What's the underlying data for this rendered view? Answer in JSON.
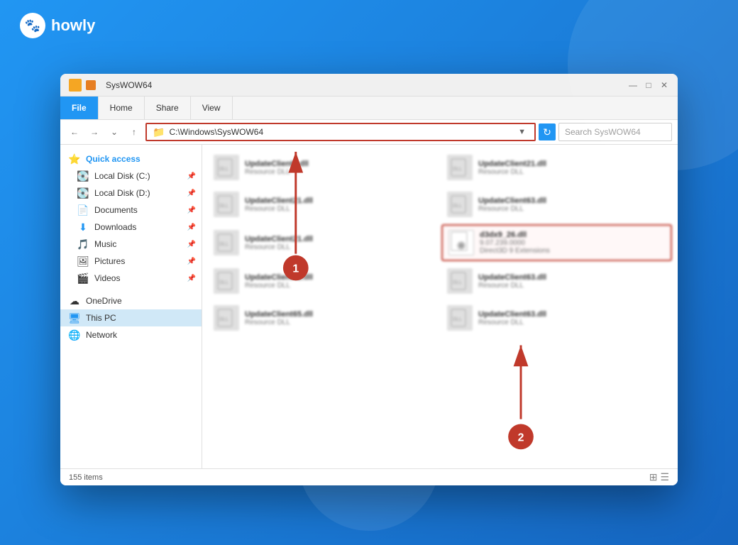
{
  "brand": {
    "name": "howly",
    "icon": "🐾"
  },
  "window": {
    "title": "SysWOW64",
    "minimize_label": "—",
    "maximize_label": "□",
    "close_label": "✕"
  },
  "ribbon": {
    "tabs": [
      {
        "id": "file",
        "label": "File",
        "active": true
      },
      {
        "id": "home",
        "label": "Home",
        "active": false
      },
      {
        "id": "share",
        "label": "Share",
        "active": false
      },
      {
        "id": "view",
        "label": "View",
        "active": false
      }
    ]
  },
  "address_bar": {
    "path": "C:\\Windows\\SysWOW64",
    "search_placeholder": "Search SysWOW64",
    "folder_icon": "📁"
  },
  "sidebar": {
    "items": [
      {
        "id": "quick-access",
        "label": "Quick access",
        "icon": "⭐",
        "type": "header"
      },
      {
        "id": "local-disk-c",
        "label": "Local Disk (C:)",
        "icon": "💽",
        "pinned": true
      },
      {
        "id": "local-disk-d",
        "label": "Local Disk (D:)",
        "icon": "💽",
        "pinned": true
      },
      {
        "id": "documents",
        "label": "Documents",
        "icon": "📄",
        "pinned": true
      },
      {
        "id": "downloads",
        "label": "Downloads",
        "icon": "⬇",
        "pinned": true
      },
      {
        "id": "music",
        "label": "Music",
        "icon": "🎵",
        "pinned": true
      },
      {
        "id": "pictures",
        "label": "Pictures",
        "icon": "🖼",
        "pinned": true
      },
      {
        "id": "videos",
        "label": "Videos",
        "icon": "🎬",
        "pinned": true
      },
      {
        "id": "onedrive",
        "label": "OneDrive",
        "icon": "☁",
        "type": "drive"
      },
      {
        "id": "this-pc",
        "label": "This PC",
        "icon": "🖥",
        "type": "drive",
        "active": true
      },
      {
        "id": "network",
        "label": "Network",
        "icon": "🌐",
        "type": "drive"
      }
    ]
  },
  "files": [
    {
      "id": "f1",
      "name": "UpdateClient5.dll",
      "desc": "Resource DLL",
      "col": 0
    },
    {
      "id": "f2",
      "name": "UpdateClient21.dll",
      "desc": "Resource DLL",
      "col": 1
    },
    {
      "id": "f3",
      "name": "UpdateClient21.dll",
      "desc": "Resource DLL",
      "col": 0
    },
    {
      "id": "f4",
      "name": "UpdateClient63.dll",
      "desc": "Resource DLL",
      "col": 1
    },
    {
      "id": "f5",
      "name": "UpdateClient21.dll",
      "desc": "Resource DLL",
      "col": 0
    },
    {
      "id": "f6-highlighted",
      "name": "d3dx9_26.dll",
      "desc": "9.07.239.0000\nDirect3D 9 Extensions",
      "desc2": "9.07.239.0000",
      "desc3": "Direct3D 9 Extensions",
      "col": 1,
      "highlight": true
    },
    {
      "id": "f7",
      "name": "UpdateClient42.dll",
      "desc": "Resource DLL",
      "col": 0
    },
    {
      "id": "f8",
      "name": "UpdateClient63.dll",
      "desc": "Resource DLL",
      "col": 1
    },
    {
      "id": "f9",
      "name": "UpdateClient65.dll",
      "desc": "Resource DLL",
      "col": 0
    },
    {
      "id": "f10",
      "name": "UpdateClient63.dll",
      "desc": "Resource DLL",
      "col": 1
    }
  ],
  "status_bar": {
    "item_count": "155 items"
  },
  "annotations": {
    "one": "1",
    "two": "2"
  }
}
